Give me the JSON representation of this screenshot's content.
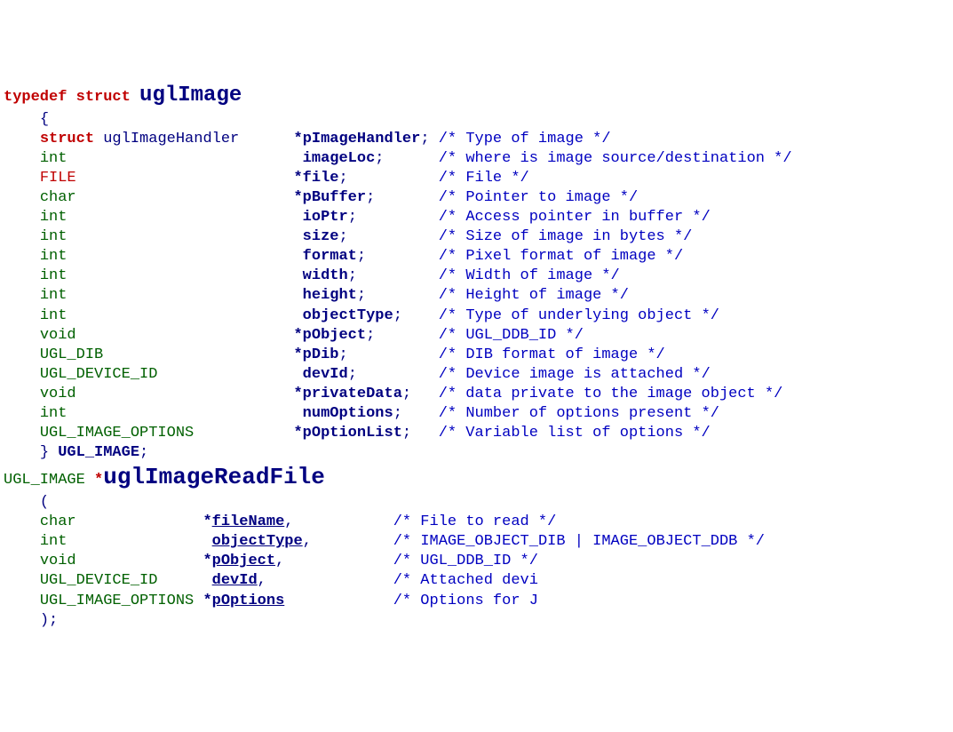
{
  "struct_decl": {
    "typedef_kw": "typedef",
    "struct_kw": "struct",
    "name": "uglImage",
    "open_brace": "{",
    "members": [
      {
        "type_kw": "struct",
        "type_extra": "uglImageHandler",
        "ptr": "*",
        "name": "pImageHandler",
        "comment_lead": "/* ",
        "comment_body": "Type of image",
        "comment_tail": " */"
      },
      {
        "type": "int",
        "name": "imageLoc",
        "comment_lead": "/* ",
        "comment_body": "where is image source/destination",
        "comment_tail": " */"
      },
      {
        "type_red": "FILE",
        "ptr": "*",
        "name": "file",
        "comment_lead": "/* ",
        "comment_body": "File",
        "comment_tail": " */"
      },
      {
        "type": "char",
        "ptr": "*",
        "name": "pBuffer",
        "comment_lead": "/* ",
        "comment_body": "Pointer to image",
        "comment_tail": " */"
      },
      {
        "type": "int",
        "name": "ioPtr",
        "comment_lead": "/* ",
        "comment_body": "Access pointer in buffer",
        "comment_tail": " */"
      },
      {
        "type": "int",
        "name": "size",
        "comment_lead": "/* ",
        "comment_body": "Size of image in bytes",
        "comment_tail": " */"
      },
      {
        "type": "int",
        "name": "format",
        "comment_lead": "/* ",
        "comment_body": "Pixel format of image",
        "comment_tail": " */"
      },
      {
        "type": "int",
        "name": "width",
        "comment_lead": "/* ",
        "comment_body": "Width of image",
        "comment_tail": " */"
      },
      {
        "type": "int",
        "name": "height",
        "comment_lead": "/* ",
        "comment_body": "Height of image",
        "comment_tail": " */"
      },
      {
        "type": "int",
        "name": "objectType",
        "comment_lead": "/* ",
        "comment_body": "Type of underlying object",
        "comment_tail": " */"
      },
      {
        "type": "void",
        "ptr": "*",
        "name": "pObject",
        "comment_lead": "/* ",
        "comment_body": "UGL_DDB_ID",
        "comment_tail": " */"
      },
      {
        "type": "UGL_DIB",
        "ptr": "*",
        "name": "pDib",
        "comment_lead": "/* ",
        "comment_body": "DIB format of image",
        "comment_tail": " */"
      },
      {
        "type": "UGL_DEVICE_ID",
        "name": "devId",
        "comment_lead": "/* ",
        "comment_body": "Device image is attached",
        "comment_tail": " */"
      },
      {
        "type": "void",
        "ptr": "*",
        "name": "privateData",
        "comment_lead": "/* ",
        "comment_body": "data private to the image object",
        "comment_tail": " */"
      },
      {
        "type": "int",
        "name": "numOptions",
        "comment_lead": "/* ",
        "comment_body": "Number of options present",
        "comment_tail": " */"
      },
      {
        "type": "UGL_IMAGE_OPTIONS",
        "ptr": "*",
        "name": "pOptionList",
        "comment_lead": "/* ",
        "comment_body": "Variable list of options",
        "comment_tail": " */"
      }
    ],
    "close_brace": "}",
    "typedef_name": "UGL_IMAGE",
    "semicolon": ";"
  },
  "func_decl": {
    "ret_type": "UGL_IMAGE",
    "ret_ptr": "*",
    "name": "uglImageReadFile",
    "open_paren": "(",
    "params": [
      {
        "type": "char",
        "ptr": "*",
        "name": "fileName",
        "sep": ",",
        "comment_lead": "/* ",
        "comment_body": "File to read",
        "comment_tail": " */"
      },
      {
        "type": "int",
        "name": "objectType",
        "sep": ",",
        "comment_lead": "/* ",
        "comment_body": "IMAGE_OBJECT_DIB | IMAGE_OBJECT_DDB",
        "comment_tail": " */"
      },
      {
        "type": "void",
        "ptr": "*",
        "name": "pObject",
        "sep": ",",
        "comment_lead": "/* ",
        "comment_body": "UGL_DDB_ID",
        "comment_tail": " */"
      },
      {
        "type": "UGL_DEVICE_ID",
        "name": "devId",
        "sep": ",",
        "comment_lead": "/* ",
        "comment_body": "Attached devi",
        "comment_tail": ""
      },
      {
        "type": "UGL_IMAGE_OPTIONS",
        "ptr": "*",
        "name": "pOptions",
        "sep": "",
        "comment_lead": "/* ",
        "comment_body": "Options for J",
        "comment_tail": ""
      }
    ],
    "close_paren": ");"
  }
}
